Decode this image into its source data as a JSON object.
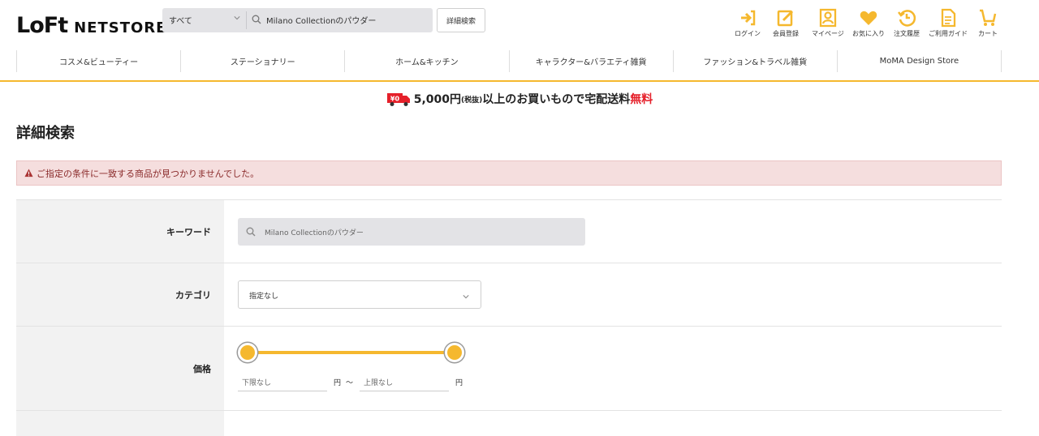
{
  "logo": {
    "mark": "LoFt",
    "text": "NETSTORE"
  },
  "search": {
    "category": "すべて",
    "value": "Milano Collectionのパウダー"
  },
  "advanced_button": "詳細検索",
  "util": [
    {
      "label": "ログイン",
      "icon": "login-icon"
    },
    {
      "label": "会員登録",
      "icon": "register-icon"
    },
    {
      "label": "マイページ",
      "icon": "mypage-icon"
    },
    {
      "label": "お気に入り",
      "icon": "heart-icon"
    },
    {
      "label": "注文履歴",
      "icon": "history-icon"
    },
    {
      "label": "ご利用ガイド",
      "icon": "guide-icon"
    },
    {
      "label": "カート",
      "icon": "cart-icon"
    }
  ],
  "nav": [
    "コスメ&ビューティー",
    "ステーショナリー",
    "ホーム&キッチン",
    "キャラクター&バラエティ雑貨",
    "ファッション&トラベル雑貨",
    "MoMA Design Store"
  ],
  "banner": {
    "amount": "5,000円",
    "tax": "(税抜)",
    "text": "以上のお買いもので宅配送料",
    "free": "無料",
    "badge": "¥0"
  },
  "page_title": "詳細検索",
  "alert": "ご指定の条件に一致する商品が見つかりませんでした。",
  "form": {
    "keyword_label": "キーワード",
    "keyword_value": "Milano Collectionのパウダー",
    "category_label": "カテゴリ",
    "category_value": "指定なし",
    "price_label": "価格",
    "price_min_placeholder": "下限なし",
    "price_max_placeholder": "上限なし",
    "yen": "円",
    "tilde": "〜"
  },
  "colors": {
    "accent": "#f5b82e",
    "alert_bg": "#f5dede",
    "free_red": "#e5202a",
    "swatches": [
      "#e87ac8",
      "#e5202a",
      "#f28a1e",
      "#f5d21e",
      "#3aa64a",
      "#1e3a7a",
      "#2a64c8",
      "#7a2ac8",
      "#d0d0d0",
      "#8a4a1e",
      "#ffffff",
      "#b0b0b0",
      "#111111",
      "#c8b88a",
      "#d8d8e8",
      "#f5a01e"
    ]
  }
}
